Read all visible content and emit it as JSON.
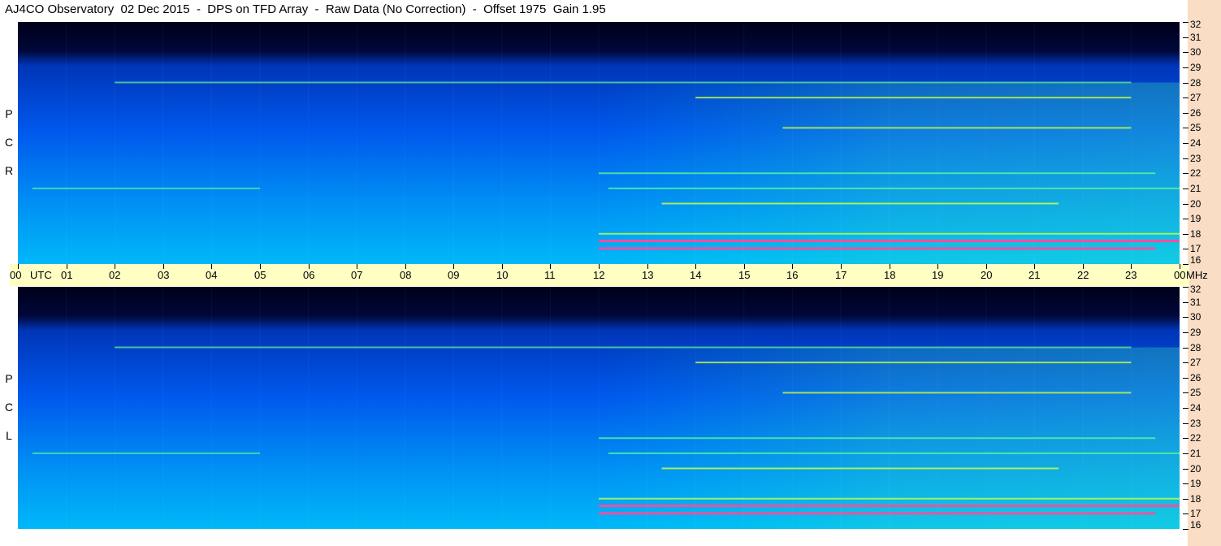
{
  "title": "AJ4CO Observatory  02 Dec 2015  -  DPS on TFD Array  -  Raw Data (No Correction)  -  Offset 1975  Gain 1.95",
  "colors": {
    "background": "#ffffff",
    "utc_band": "#ffffc4",
    "right_strip": "#f9ddc4",
    "spectrogram_low": "#00001a",
    "spectrogram_mid": "#0050ff",
    "spectrogram_high": "#60ff60",
    "spectrogram_peak": "#ff3090"
  },
  "panels": [
    {
      "label_letters": [
        "R",
        "C",
        "P"
      ]
    },
    {
      "label_letters": [
        "L",
        "C",
        "P"
      ]
    }
  ],
  "utc_axis": {
    "labels": [
      "00",
      "UTC",
      "01",
      "02",
      "03",
      "04",
      "05",
      "06",
      "07",
      "08",
      "09",
      "10",
      "11",
      "12",
      "13",
      "14",
      "15",
      "16",
      "17",
      "18",
      "19",
      "20",
      "21",
      "22",
      "23",
      "00",
      "MHz"
    ]
  },
  "chart_data": {
    "type": "heatmap",
    "x_unit": "UTC hour",
    "x_range": [
      0,
      24
    ],
    "y_unit": "MHz",
    "y_range": [
      16,
      32
    ],
    "y_ticks": [
      "32",
      "31",
      "30",
      "29",
      "28",
      "27",
      "26",
      "25",
      "24",
      "23",
      "22",
      "21",
      "20",
      "19",
      "18",
      "17",
      "16"
    ],
    "panels": [
      "RCP",
      "LCP"
    ],
    "bands": [
      {
        "freq": 17.5,
        "start": 12.0,
        "end": 24.0,
        "strength": 1.0
      },
      {
        "freq": 17.0,
        "start": 12.0,
        "end": 23.5,
        "strength": 0.9
      },
      {
        "freq": 18.0,
        "start": 12.0,
        "end": 24.0,
        "strength": 0.6
      },
      {
        "freq": 20.0,
        "start": 13.3,
        "end": 21.5,
        "strength": 0.7
      },
      {
        "freq": 21.0,
        "start": 12.2,
        "end": 24.0,
        "strength": 0.5
      },
      {
        "freq": 22.0,
        "start": 12.0,
        "end": 23.5,
        "strength": 0.5
      },
      {
        "freq": 25.0,
        "start": 15.8,
        "end": 23.0,
        "strength": 0.6
      },
      {
        "freq": 27.0,
        "start": 14.0,
        "end": 23.0,
        "strength": 0.6
      },
      {
        "freq": 28.0,
        "start": 2.0,
        "end": 23.0,
        "strength": 0.35
      },
      {
        "freq": 21.0,
        "start": 0.3,
        "end": 5.0,
        "strength": 0.3
      }
    ]
  }
}
